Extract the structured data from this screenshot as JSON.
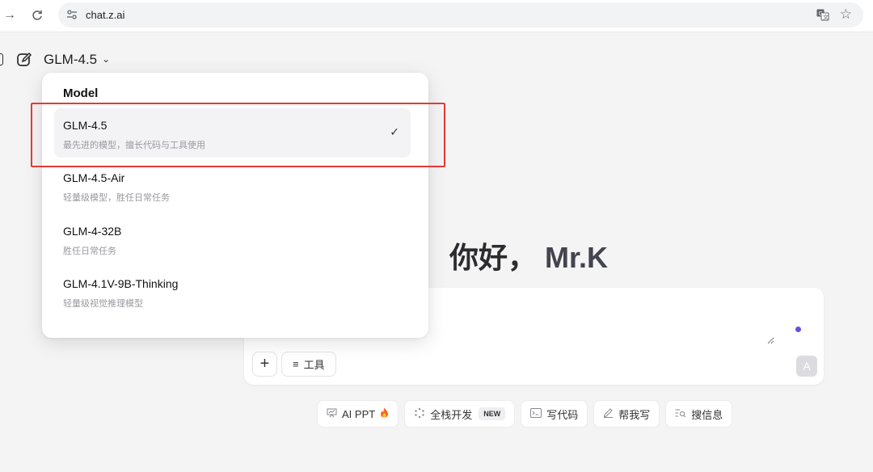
{
  "browser": {
    "url": "chat.z.ai"
  },
  "header": {
    "model_label": "GLM-4.5"
  },
  "dropdown": {
    "title": "Model",
    "options": [
      {
        "name": "GLM-4.5",
        "description": "最先进的模型，擅长代码与工具使用",
        "selected": true
      },
      {
        "name": "GLM-4.5-Air",
        "description": "轻量级模型，胜任日常任务",
        "selected": false
      },
      {
        "name": "GLM-4-32B",
        "description": "胜任日常任务",
        "selected": false
      },
      {
        "name": "GLM-4.1V-9B-Thinking",
        "description": "轻量级视觉推理模型",
        "selected": false
      }
    ]
  },
  "greeting": {
    "hello": "你好，",
    "user": "Mr.K"
  },
  "composer": {
    "placeholder": "",
    "tools_label": "工具",
    "send_glyph": "A"
  },
  "chips": [
    {
      "label": "AI PPT",
      "icon": "presentation-icon",
      "suffix_icon": "fire-icon"
    },
    {
      "label": "全栈开发",
      "icon": "loading-dots-icon",
      "badge": "NEW"
    },
    {
      "label": "写代码",
      "icon": "terminal-icon"
    },
    {
      "label": "帮我写",
      "icon": "pen-icon"
    },
    {
      "label": "搜信息",
      "icon": "search-list-icon"
    }
  ],
  "colors": {
    "accent_dot": "#6b4de6",
    "highlight": "#e53935",
    "background": "#f4f4f5"
  }
}
